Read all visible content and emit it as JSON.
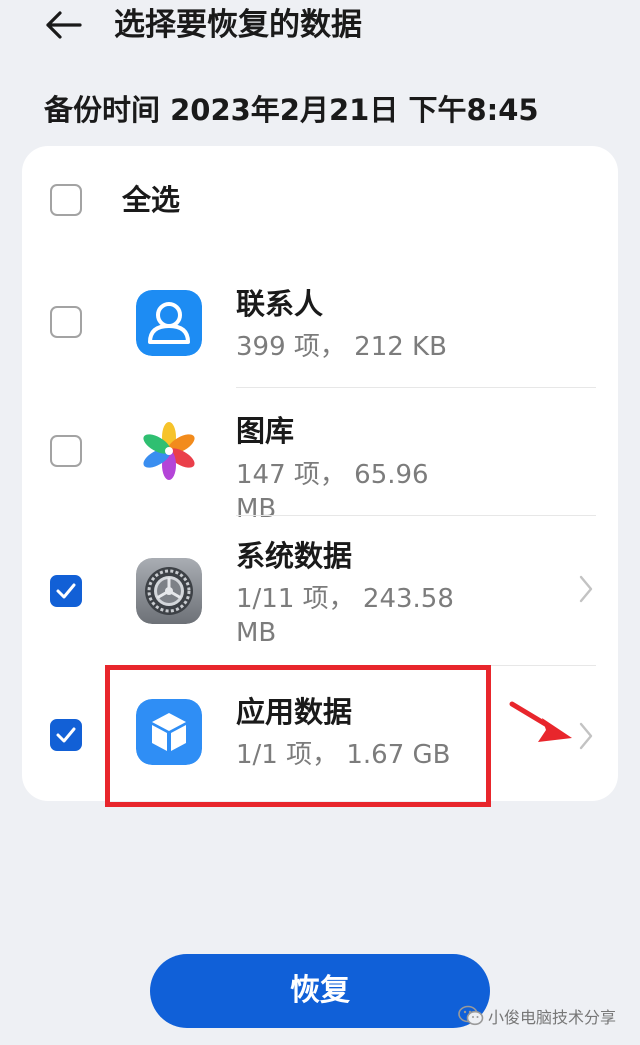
{
  "header": {
    "title": "选择要恢复的数据",
    "back_icon": "arrow-left-icon"
  },
  "backup_time": "备份时间 2023年2月21日 下午8:45",
  "select_all": {
    "label": "全选",
    "checked": false
  },
  "items": [
    {
      "title": "联系人",
      "subtitle": "399 项， 212 KB",
      "checked": false,
      "icon": "contacts-icon",
      "has_chevron": false
    },
    {
      "title": "图库",
      "subtitle": "147 项， 65.96 MB",
      "checked": false,
      "icon": "gallery-icon",
      "has_chevron": false
    },
    {
      "title": "系统数据",
      "subtitle": "1/11 项， 243.58 MB",
      "checked": true,
      "icon": "settings-gear-icon",
      "has_chevron": true
    },
    {
      "title": "应用数据",
      "subtitle": "1/1 项， 1.67 GB",
      "checked": true,
      "icon": "app-data-cube-icon",
      "has_chevron": true
    }
  ],
  "restore_button": {
    "label": "恢复"
  },
  "watermark": {
    "text": "小俊电脑技术分享",
    "icon": "wechat-icon"
  },
  "colors": {
    "accent": "#1060d8",
    "annotation": "#e8262c",
    "background": "#eef0f4"
  }
}
